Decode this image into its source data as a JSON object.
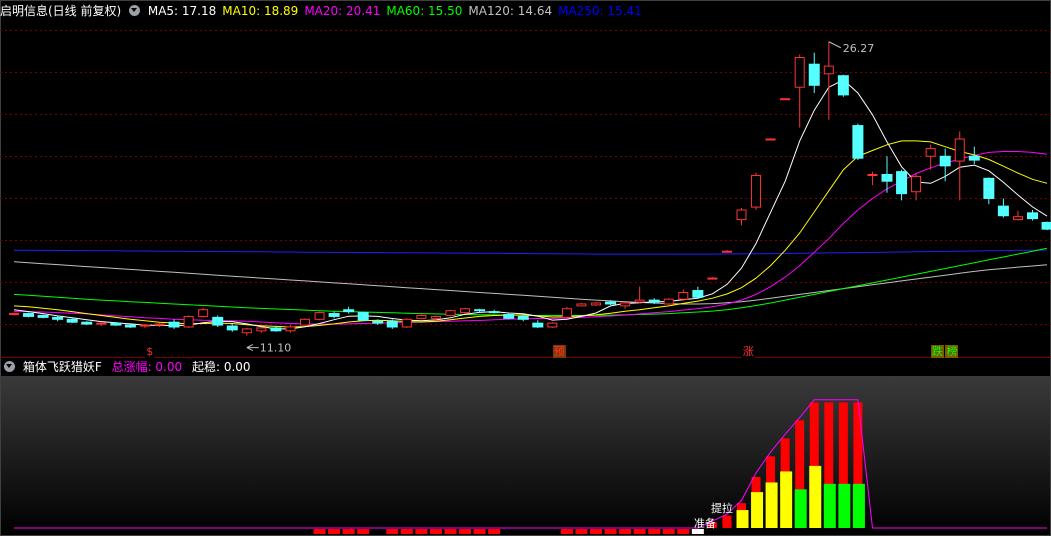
{
  "main_panel": {
    "title": "启明信息(日线 前复权)",
    "ma_labels": [
      {
        "text": "MA5: 17.18",
        "color": "#ffffff"
      },
      {
        "text": "MA10: 18.89",
        "color": "#ffff00"
      },
      {
        "text": "MA20: 20.41",
        "color": "#ff00ff"
      },
      {
        "text": "MA60: 15.50",
        "color": "#00ff00"
      },
      {
        "text": "MA120: 14.64",
        "color": "#c0c0c0"
      },
      {
        "text": "MA250: 15.41",
        "color": "#0000ff"
      }
    ],
    "annotations": {
      "high": "26.27",
      "low": "11.10"
    },
    "signals": [
      {
        "text": "$",
        "color": "#ff3030",
        "bg": "#000000",
        "x_bar": 9.5
      },
      {
        "text": "预",
        "color": "#ff3030",
        "bg": "#7a3a00",
        "x_bar": 37.5
      },
      {
        "text": "涨",
        "color": "#ff3030",
        "bg": "#000000",
        "x_bar": 50.5
      },
      {
        "text": "跌",
        "color": "#00ff00",
        "bg": "#7a5a00",
        "x_bar": 63.5
      },
      {
        "text": "榜",
        "color": "#00ff00",
        "bg": "#7a5a00",
        "x_bar": 64.5
      }
    ]
  },
  "indicator_panel": {
    "name": "箱体飞跃猎妖F",
    "total_label": "总涨幅: 0.00",
    "stable_label": "起稳: 0.00",
    "labels": {
      "ready": "准备",
      "lift": "提拉"
    }
  },
  "colors": {
    "up": "#ff3232",
    "down": "#54ffff",
    "grid": "#7a0000",
    "purple": "#ff00ff",
    "bar_red": "#ff0000",
    "bar_yellow": "#ffff00",
    "bar_green": "#00ff00"
  },
  "chart_data": {
    "type": "candlestick",
    "ohlc": [
      [
        12.05,
        12.15,
        12.0,
        12.1
      ],
      [
        12.1,
        12.15,
        11.9,
        11.95
      ],
      [
        12.0,
        12.05,
        11.85,
        11.9
      ],
      [
        11.9,
        12.0,
        11.7,
        11.8
      ],
      [
        11.8,
        11.85,
        11.6,
        11.65
      ],
      [
        11.65,
        11.7,
        11.5,
        11.55
      ],
      [
        11.55,
        11.65,
        11.45,
        11.6
      ],
      [
        11.6,
        11.65,
        11.45,
        11.5
      ],
      [
        11.5,
        11.55,
        11.35,
        11.4
      ],
      [
        11.45,
        11.55,
        11.35,
        11.5
      ],
      [
        11.5,
        11.6,
        11.4,
        11.55
      ],
      [
        11.65,
        11.8,
        11.3,
        11.4
      ],
      [
        11.4,
        12.0,
        11.35,
        11.95
      ],
      [
        11.95,
        12.4,
        11.9,
        12.3
      ],
      [
        11.9,
        12.0,
        11.4,
        11.5
      ],
      [
        11.45,
        11.55,
        11.15,
        11.25
      ],
      [
        11.1,
        11.35,
        10.95,
        11.3
      ],
      [
        11.2,
        11.4,
        11.1,
        11.35
      ],
      [
        11.35,
        11.45,
        11.15,
        11.2
      ],
      [
        11.2,
        11.5,
        11.1,
        11.4
      ],
      [
        11.5,
        11.85,
        11.45,
        11.8
      ],
      [
        11.8,
        12.2,
        11.75,
        12.15
      ],
      [
        12.1,
        12.2,
        11.85,
        11.95
      ],
      [
        12.3,
        12.45,
        12.1,
        12.2
      ],
      [
        12.15,
        12.2,
        11.7,
        11.75
      ],
      [
        11.7,
        11.8,
        11.5,
        11.6
      ],
      [
        11.7,
        11.8,
        11.3,
        11.4
      ],
      [
        11.4,
        11.85,
        11.35,
        11.8
      ],
      [
        11.85,
        12.05,
        11.8,
        12.0
      ],
      [
        11.85,
        12.0,
        11.75,
        11.95
      ],
      [
        12.0,
        12.3,
        11.95,
        12.25
      ],
      [
        12.15,
        12.4,
        12.1,
        12.35
      ],
      [
        12.3,
        12.35,
        12.15,
        12.25
      ],
      [
        12.2,
        12.3,
        12.1,
        12.15
      ],
      [
        12.05,
        12.1,
        11.8,
        11.85
      ],
      [
        11.95,
        12.05,
        11.7,
        11.8
      ],
      [
        11.6,
        11.75,
        11.35,
        11.4
      ],
      [
        11.4,
        11.65,
        11.35,
        11.6
      ],
      [
        11.9,
        12.45,
        11.9,
        12.35
      ],
      [
        12.5,
        12.65,
        12.5,
        12.6
      ],
      [
        12.55,
        12.7,
        12.5,
        12.65
      ],
      [
        12.7,
        12.8,
        12.55,
        12.6
      ],
      [
        12.5,
        12.7,
        12.35,
        12.65
      ],
      [
        12.7,
        13.5,
        12.65,
        12.8
      ],
      [
        12.8,
        12.9,
        12.6,
        12.7
      ],
      [
        12.6,
        12.9,
        12.5,
        12.85
      ],
      [
        12.85,
        13.35,
        12.75,
        13.2
      ],
      [
        13.3,
        13.5,
        12.9,
        12.95
      ],
      [
        13.95,
        14.0,
        13.95,
        13.95
      ],
      [
        15.35,
        15.4,
        15.35,
        15.35
      ],
      [
        17.0,
        17.6,
        16.7,
        17.5
      ],
      [
        17.65,
        19.45,
        17.5,
        19.3
      ],
      [
        21.2,
        21.25,
        21.15,
        21.2
      ],
      [
        23.3,
        23.3,
        23.3,
        23.3
      ],
      [
        23.9,
        25.6,
        21.8,
        25.45
      ],
      [
        25.1,
        25.7,
        23.6,
        24.0
      ],
      [
        24.6,
        26.27,
        22.2,
        25.0
      ],
      [
        24.5,
        24.55,
        23.4,
        23.5
      ],
      [
        21.9,
        22.0,
        20.1,
        20.2
      ],
      [
        19.3,
        19.5,
        18.8,
        19.35
      ],
      [
        19.35,
        20.3,
        18.4,
        19.0
      ],
      [
        19.5,
        19.6,
        18.0,
        18.35
      ],
      [
        18.45,
        19.4,
        18.0,
        19.25
      ],
      [
        20.3,
        20.9,
        19.6,
        20.7
      ],
      [
        20.3,
        20.7,
        19.0,
        19.8
      ],
      [
        20.05,
        21.6,
        18.0,
        21.2
      ],
      [
        20.3,
        20.8,
        19.9,
        20.1
      ],
      [
        19.15,
        19.2,
        17.8,
        18.1
      ],
      [
        17.7,
        18.1,
        17.1,
        17.2
      ],
      [
        17.0,
        17.45,
        16.95,
        17.15
      ],
      [
        17.35,
        17.5,
        16.95,
        17.05
      ],
      [
        16.85,
        16.9,
        16.45,
        16.5
      ]
    ],
    "ma5": [
      12.3,
      12.2,
      12.1,
      11.98,
      11.88,
      11.78,
      11.68,
      11.62,
      11.56,
      11.5,
      11.48,
      11.47,
      11.5,
      11.62,
      11.7,
      11.68,
      11.56,
      11.42,
      11.3,
      11.3,
      11.41,
      11.58,
      11.78,
      11.96,
      11.98,
      11.95,
      11.84,
      11.76,
      11.72,
      11.77,
      11.88,
      12.06,
      12.16,
      12.2,
      12.13,
      12.09,
      11.96,
      11.76,
      11.8,
      11.95,
      12.13,
      12.5,
      12.63,
      12.66,
      12.71,
      12.73,
      12.83,
      12.9,
      13.13,
      13.62,
      14.47,
      15.76,
      17.38,
      19.0,
      21.1,
      22.7,
      23.9,
      24.28,
      23.6,
      22.46,
      21.05,
      19.75,
      18.96,
      18.89,
      19.25,
      19.73,
      19.84,
      19.54,
      18.95,
      18.28,
      17.66,
      17.18
    ],
    "ma10": [
      12.5,
      12.45,
      12.38,
      12.3,
      12.2,
      12.1,
      12.0,
      11.9,
      11.8,
      11.72,
      11.65,
      11.6,
      11.57,
      11.58,
      11.6,
      11.58,
      11.52,
      11.46,
      11.43,
      11.4,
      11.42,
      11.48,
      11.56,
      11.66,
      11.72,
      11.75,
      11.72,
      11.68,
      11.66,
      11.7,
      11.78,
      11.87,
      11.95,
      12.0,
      12.02,
      12.03,
      11.98,
      11.92,
      11.93,
      11.98,
      12.03,
      12.12,
      12.22,
      12.3,
      12.4,
      12.5,
      12.63,
      12.75,
      12.9,
      13.12,
      13.45,
      13.95,
      14.6,
      15.4,
      16.3,
      17.4,
      18.5,
      19.6,
      20.3,
      20.6,
      20.9,
      21.1,
      21.1,
      21.05,
      20.8,
      20.55,
      20.37,
      20.13,
      19.78,
      19.42,
      19.1,
      18.89
    ],
    "ma20": [
      12.2,
      12.2,
      12.18,
      12.15,
      12.12,
      12.08,
      12.03,
      11.98,
      11.93,
      11.88,
      11.85,
      11.8,
      11.78,
      11.75,
      11.74,
      11.72,
      11.7,
      11.66,
      11.62,
      11.58,
      11.56,
      11.55,
      11.55,
      11.56,
      11.58,
      11.6,
      11.62,
      11.64,
      11.66,
      11.68,
      11.7,
      11.72,
      11.74,
      11.78,
      11.8,
      11.82,
      11.84,
      11.85,
      11.87,
      11.9,
      11.93,
      11.97,
      12.02,
      12.08,
      12.14,
      12.2,
      12.28,
      12.36,
      12.45,
      12.6,
      12.8,
      13.1,
      13.5,
      14.0,
      14.6,
      15.3,
      16.0,
      16.8,
      17.5,
      18.1,
      18.6,
      19.0,
      19.4,
      19.7,
      19.95,
      20.15,
      20.35,
      20.5,
      20.55,
      20.55,
      20.5,
      20.41
    ],
    "ma60": [
      13.1,
      13.05,
      13.0,
      12.95,
      12.9,
      12.85,
      12.8,
      12.76,
      12.72,
      12.68,
      12.64,
      12.6,
      12.56,
      12.52,
      12.48,
      12.44,
      12.4,
      12.37,
      12.34,
      12.31,
      12.28,
      12.25,
      12.22,
      12.2,
      12.18,
      12.16,
      12.14,
      12.12,
      12.1,
      12.08,
      12.06,
      12.05,
      12.04,
      12.03,
      12.02,
      12.01,
      12.0,
      12.0,
      12.0,
      12.0,
      12.01,
      12.02,
      12.03,
      12.05,
      12.07,
      12.1,
      12.14,
      12.18,
      12.23,
      12.3,
      12.4,
      12.52,
      12.65,
      12.8,
      12.95,
      13.1,
      13.25,
      13.4,
      13.55,
      13.7,
      13.85,
      14.0,
      14.15,
      14.3,
      14.45,
      14.6,
      14.75,
      14.9,
      15.05,
      15.2,
      15.35,
      15.5
    ],
    "ma120": [
      14.8,
      14.75,
      14.7,
      14.65,
      14.6,
      14.55,
      14.5,
      14.45,
      14.4,
      14.35,
      14.3,
      14.25,
      14.2,
      14.15,
      14.1,
      14.05,
      14.0,
      13.95,
      13.9,
      13.85,
      13.8,
      13.75,
      13.7,
      13.65,
      13.6,
      13.55,
      13.5,
      13.45,
      13.4,
      13.35,
      13.3,
      13.25,
      13.2,
      13.15,
      13.1,
      13.05,
      13.0,
      12.95,
      12.9,
      12.85,
      12.8,
      12.76,
      12.72,
      12.68,
      12.65,
      12.62,
      12.6,
      12.6,
      12.62,
      12.66,
      12.72,
      12.8,
      12.9,
      13.0,
      13.1,
      13.2,
      13.3,
      13.4,
      13.5,
      13.6,
      13.7,
      13.8,
      13.9,
      14.0,
      14.1,
      14.2,
      14.3,
      14.38,
      14.45,
      14.52,
      14.58,
      14.64
    ],
    "ma250": [
      15.4,
      15.4,
      15.39,
      15.39,
      15.38,
      15.38,
      15.37,
      15.37,
      15.36,
      15.36,
      15.35,
      15.35,
      15.34,
      15.34,
      15.33,
      15.33,
      15.32,
      15.32,
      15.31,
      15.31,
      15.3,
      15.3,
      15.29,
      15.29,
      15.28,
      15.28,
      15.27,
      15.27,
      15.26,
      15.26,
      15.25,
      15.25,
      15.24,
      15.24,
      15.23,
      15.23,
      15.22,
      15.22,
      15.21,
      15.21,
      15.2,
      15.2,
      15.2,
      15.2,
      15.2,
      15.2,
      15.2,
      15.2,
      15.2,
      15.21,
      15.21,
      15.22,
      15.22,
      15.23,
      15.24,
      15.25,
      15.26,
      15.27,
      15.28,
      15.29,
      15.3,
      15.31,
      15.32,
      15.33,
      15.34,
      15.35,
      15.36,
      15.37,
      15.38,
      15.39,
      15.4,
      15.41
    ],
    "ylim": [
      10.2,
      27.3
    ],
    "indicator": {
      "purple_line": [
        0,
        0,
        0,
        0,
        0,
        0,
        0,
        0,
        0,
        0,
        0,
        0,
        0,
        0,
        0,
        0,
        0,
        0,
        0,
        0,
        0,
        0,
        0,
        0,
        0,
        0,
        0,
        0,
        0,
        0,
        0,
        0,
        0,
        0,
        0,
        0,
        0,
        0,
        0,
        0,
        0,
        0,
        0,
        0,
        0,
        0,
        0,
        0,
        0.05,
        0.1,
        0.2,
        0.4,
        0.55,
        0.68,
        0.8,
        0.93,
        0.93,
        0.93,
        0.93,
        0,
        0,
        0,
        0,
        0,
        0,
        0,
        0,
        0,
        0,
        0,
        0,
        0
      ],
      "red_top": [
        0,
        0,
        0,
        0,
        0,
        0,
        0,
        0,
        0,
        0,
        0,
        0,
        0,
        0,
        0,
        0,
        0,
        0,
        0,
        0,
        0,
        0,
        0,
        0,
        0,
        0,
        0,
        0,
        0,
        0,
        0,
        0,
        0,
        0,
        0,
        0,
        0,
        0,
        0,
        0,
        0,
        0,
        0,
        0,
        0,
        0,
        0,
        0,
        0.04,
        0.09,
        0.18,
        0.37,
        0.52,
        0.65,
        0.78,
        0.91,
        0.91,
        0.91,
        0.91,
        0,
        0,
        0,
        0,
        0,
        0,
        0,
        0,
        0,
        0,
        0,
        0,
        0
      ],
      "yellow_top": [
        0,
        0,
        0,
        0,
        0,
        0,
        0,
        0,
        0,
        0,
        0,
        0,
        0,
        0,
        0,
        0,
        0,
        0,
        0,
        0,
        0,
        0,
        0,
        0,
        0,
        0,
        0,
        0,
        0,
        0,
        0,
        0,
        0,
        0,
        0,
        0,
        0,
        0,
        0,
        0,
        0,
        0,
        0,
        0,
        0,
        0,
        0,
        0,
        0,
        0,
        0.13,
        0.26,
        0.33,
        0.41,
        0,
        0.45,
        0,
        0,
        0,
        0,
        0,
        0,
        0,
        0,
        0,
        0,
        0,
        0,
        0,
        0,
        0,
        0
      ],
      "green_top": [
        0,
        0,
        0,
        0,
        0,
        0,
        0,
        0,
        0,
        0,
        0,
        0,
        0,
        0,
        0,
        0,
        0,
        0,
        0,
        0,
        0,
        0,
        0,
        0,
        0,
        0,
        0,
        0,
        0,
        0,
        0,
        0,
        0,
        0,
        0,
        0,
        0,
        0,
        0,
        0,
        0,
        0,
        0,
        0,
        0,
        0,
        0,
        0,
        0,
        0,
        0,
        0,
        0,
        0,
        0.28,
        0,
        0.32,
        0.32,
        0.32,
        0,
        0,
        0,
        0,
        0,
        0,
        0,
        0,
        0,
        0,
        0,
        0,
        0
      ],
      "bottom_markers": [
        0,
        0,
        0,
        0,
        0,
        0,
        0,
        0,
        0,
        0,
        0,
        0,
        0,
        0,
        0,
        0,
        0,
        0,
        0,
        0,
        0,
        1,
        1,
        1,
        1,
        0,
        1,
        1,
        1,
        1,
        1,
        1,
        1,
        1,
        0,
        0,
        0,
        0,
        1,
        1,
        1,
        1,
        1,
        1,
        1,
        1,
        1,
        2,
        0,
        0,
        0,
        0,
        0,
        0,
        0,
        0,
        0,
        0,
        0,
        0,
        0,
        0,
        0,
        0,
        0,
        0,
        0,
        0,
        0,
        0,
        0,
        0
      ]
    }
  }
}
